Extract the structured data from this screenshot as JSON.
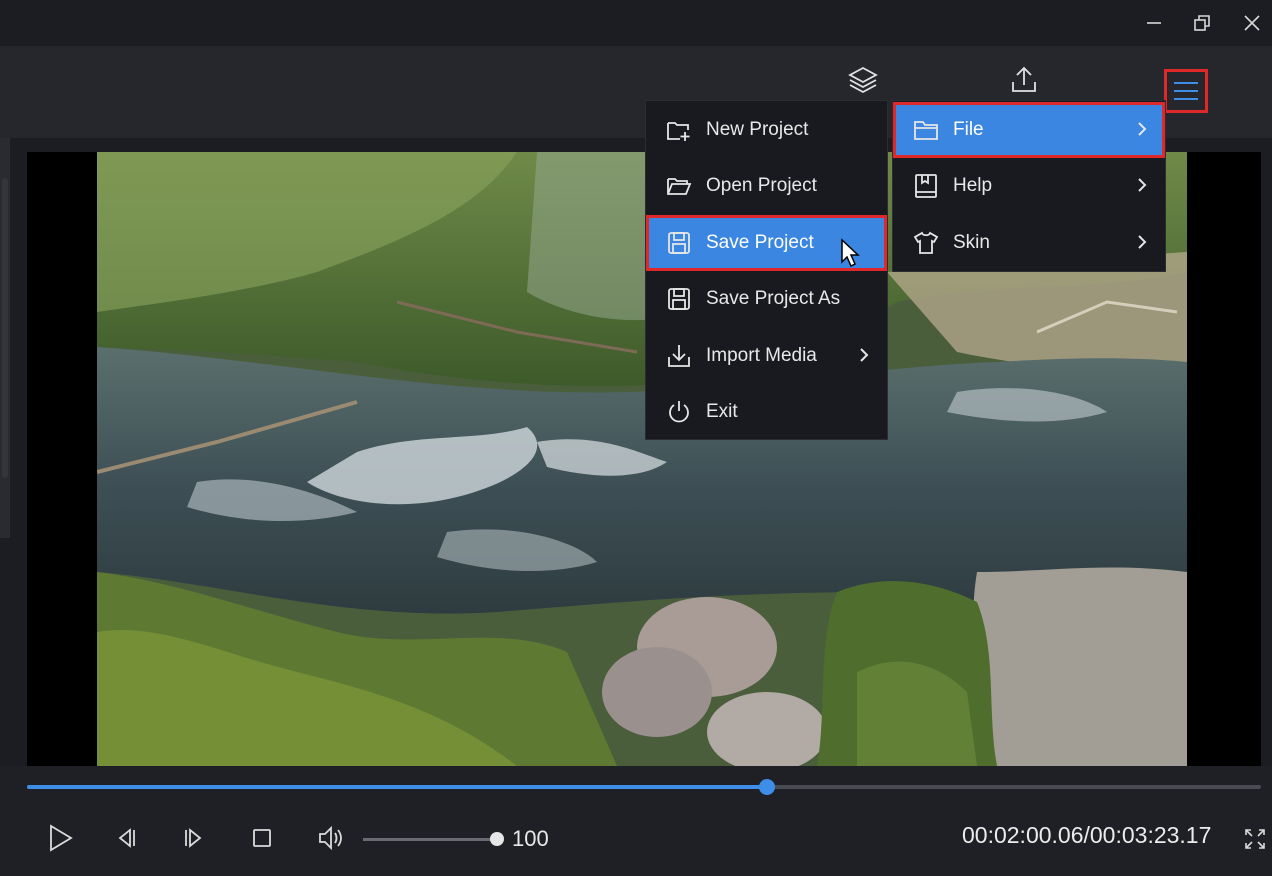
{
  "colors": {
    "accent": "#3e8ee8",
    "highlight_border": "#e0282a",
    "menu_bg": "#191a20",
    "active_item": "#3a86e0"
  },
  "window": {
    "controls": [
      {
        "name": "minimize",
        "icon": "minimize-icon"
      },
      {
        "name": "restore",
        "icon": "restore-icon"
      },
      {
        "name": "close",
        "icon": "close-icon"
      }
    ]
  },
  "toolbar": {
    "icons": [
      "layers-icon",
      "export-icon",
      "hamburger-menu-icon"
    ]
  },
  "main_menu": {
    "items": [
      {
        "label": "File",
        "icon": "folder-icon",
        "active": true,
        "has_submenu": true
      },
      {
        "label": "Help",
        "icon": "book-icon",
        "active": false,
        "has_submenu": true
      },
      {
        "label": "Skin",
        "icon": "shirt-icon",
        "active": false,
        "has_submenu": true
      }
    ]
  },
  "file_menu": {
    "items": [
      {
        "label": "New Project",
        "icon": "new-folder-icon",
        "has_submenu": false
      },
      {
        "label": "Open Project",
        "icon": "open-folder-icon",
        "has_submenu": false
      },
      {
        "label": "Save Project",
        "icon": "save-icon",
        "has_submenu": false,
        "active": true
      },
      {
        "label": "Save Project As",
        "icon": "save-as-icon",
        "has_submenu": false
      },
      {
        "label": "Import Media",
        "icon": "import-icon",
        "has_submenu": true
      },
      {
        "label": "Exit",
        "icon": "power-icon",
        "has_submenu": false
      }
    ]
  },
  "player": {
    "progress_fraction": 0.6,
    "volume": "100",
    "volume_fraction": 1.0,
    "time": "00:02:00.06/00:03:23.17",
    "controls": [
      "play-icon",
      "previous-frame-icon",
      "next-frame-icon",
      "stop-icon",
      "volume-icon"
    ]
  }
}
